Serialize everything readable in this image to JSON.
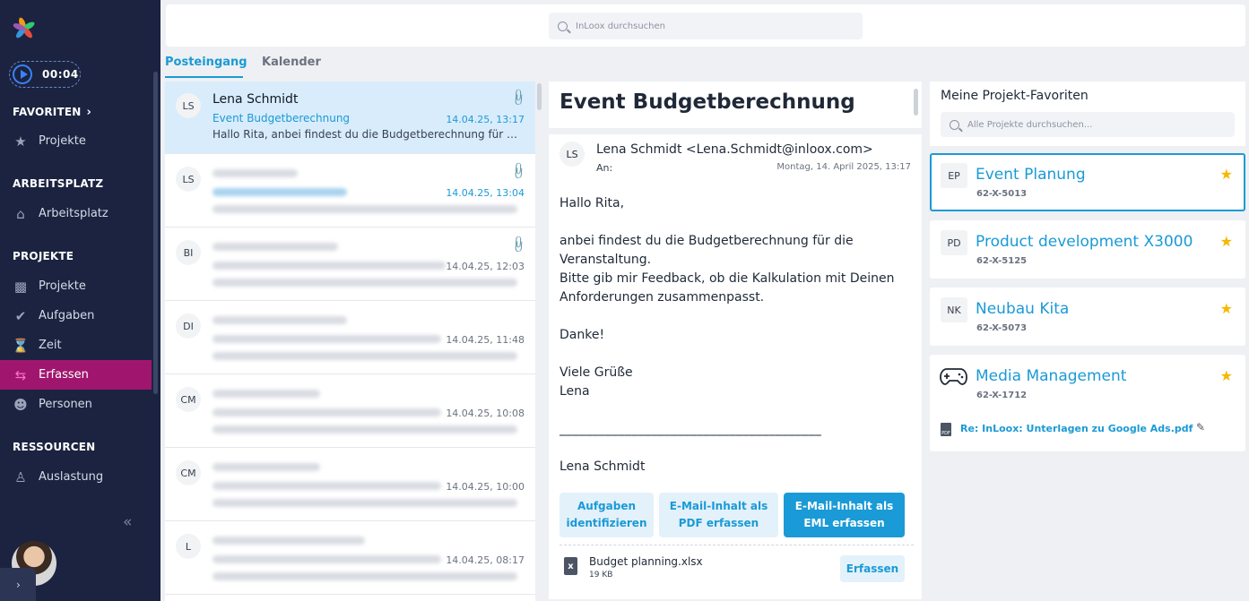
{
  "sidebar": {
    "timer": "00:04",
    "sections": {
      "favoriten": "FAVORITEN",
      "arbeitsplatz": "ARBEITSPLATZ",
      "projekte": "PROJEKTE",
      "ressourcen": "RESSOURCEN"
    },
    "items": {
      "fav_projekte": "Projekte",
      "arbeitsplatz": "Arbeitsplatz",
      "projekte": "Projekte",
      "aufgaben": "Aufgaben",
      "zeit": "Zeit",
      "erfassen": "Erfassen",
      "personen": "Personen",
      "auslastung": "Auslastung"
    },
    "active_item": "Erfassen"
  },
  "search": {
    "placeholder": "InLoox durchsuchen"
  },
  "tabs": {
    "inbox": "Posteingang",
    "calendar": "Kalender",
    "active": "Posteingang"
  },
  "mails": [
    {
      "initials": "LS",
      "sender": "Lena Schmidt",
      "subject": "Event Budgetberechnung",
      "date": "14.04.25, 13:17",
      "preview": "Hallo Rita, anbei findest du die Budgetberechnung für die Veranstaltung.",
      "attachment": true,
      "selected": true
    },
    {
      "initials": "LS",
      "date": "14.04.25, 13:04",
      "attachment": true
    },
    {
      "initials": "BI",
      "date": "14.04.25, 12:03",
      "attachment": true
    },
    {
      "initials": "DI",
      "date": "14.04.25, 11:48"
    },
    {
      "initials": "CM",
      "date": "14.04.25, 10:08"
    },
    {
      "initials": "CM",
      "date": "14.04.25, 10:00"
    },
    {
      "initials": "L",
      "date": "14.04.25, 08:17"
    }
  ],
  "detail": {
    "title": "Event Budgetberechnung",
    "initials": "LS",
    "from": "Lena Schmidt <Lena.Schmidt@inloox.com>",
    "to_label": "An:",
    "date": "Montag, 14. April 2025, 13:17",
    "body": {
      "greeting": "Hallo Rita,",
      "p1_line1": "anbei findest du die Budgetberechnung für die",
      "p1_line2": "Veranstaltung.",
      "p1_line3": "Bitte gib mir Feedback, ob die Kalkulation mit Deinen",
      "p1_line4": "Anforderungen zusammenpasst.",
      "thanks": "Danke!",
      "regards": "Viele Grüße",
      "name": "Lena",
      "divider": "________________________________________",
      "signature": "Lena Schmidt"
    },
    "actions": {
      "identify_l1": "Aufgaben",
      "identify_l2": "identifizieren",
      "pdf_l1": "E-Mail-Inhalt als",
      "pdf_l2": "PDF erfassen",
      "eml_l1": "E-Mail-Inhalt als",
      "eml_l2": "EML erfassen"
    },
    "attachment": {
      "name": "Budget planning.xlsx",
      "size": "19 KB",
      "button": "Erfassen",
      "icon": "x"
    }
  },
  "favorites": {
    "title": "Meine Projekt-Favoriten",
    "search_placeholder": "Alle Projekte durchsuchen...",
    "projects": [
      {
        "badge": "EP",
        "name": "Event Planung",
        "code": "62-X-5013",
        "starred": true,
        "active": true
      },
      {
        "badge": "PD",
        "name": "Product development X3000",
        "code": "62-X-5125",
        "starred": true
      },
      {
        "badge": "NK",
        "name": "Neubau Kita",
        "code": "62-X-5073",
        "starred": true
      },
      {
        "icon": "gamepad-icon",
        "name": "Media Management",
        "code": "62-X-1712",
        "starred": true,
        "document": "Re: InLoox: Unterlagen zu Google Ads.pdf"
      }
    ]
  },
  "colors": {
    "sidebar": "#1b2340",
    "accent": "#1a9ad6",
    "active_nav": "#a0166e",
    "star": "#f5b800"
  }
}
